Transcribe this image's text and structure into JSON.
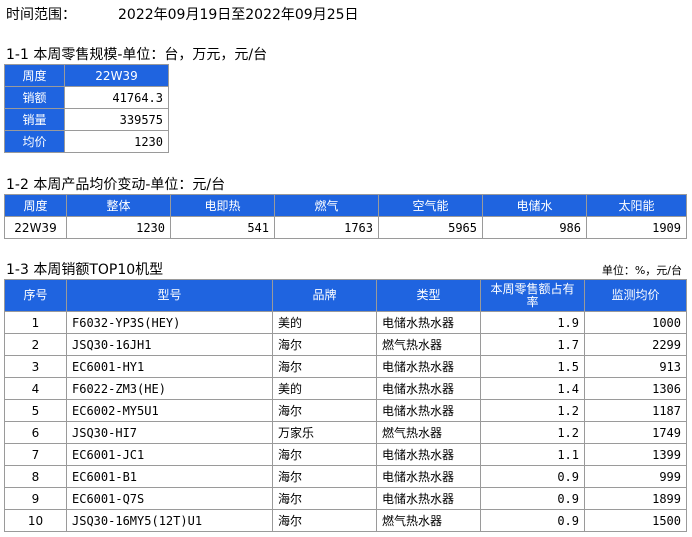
{
  "period": {
    "label": "时间范围：",
    "value": "2022年09月19日至2022年09月25日"
  },
  "section1": {
    "title": "1-1 本周零售规模-单位：台，万元，元/台",
    "rows": [
      {
        "label": "周度",
        "value": "22W39"
      },
      {
        "label": "销额",
        "value": "41764.3"
      },
      {
        "label": "销量",
        "value": "339575"
      },
      {
        "label": "均价",
        "value": "1230"
      }
    ]
  },
  "section2": {
    "title": "1-2 本周产品均价变动-单位：元/台",
    "headers": [
      "周度",
      "整体",
      "电即热",
      "燃气",
      "空气能",
      "电储水",
      "太阳能"
    ],
    "row": [
      "22W39",
      "1230",
      "541",
      "1763",
      "5965",
      "986",
      "1909"
    ]
  },
  "section3": {
    "title": "1-3 本周销额TOP10机型",
    "unit": "单位：%，元/台",
    "headers": [
      "序号",
      "型号",
      "品牌",
      "类型",
      "本周零售额占有率",
      "监测均价"
    ],
    "rows": [
      [
        "1",
        "F6032-YP3S(HEY)",
        "美的",
        "电储水热水器",
        "1.9",
        "1000"
      ],
      [
        "2",
        "JSQ30-16JH1",
        "海尔",
        "燃气热水器",
        "1.7",
        "2299"
      ],
      [
        "3",
        "EC6001-HY1",
        "海尔",
        "电储水热水器",
        "1.5",
        "913"
      ],
      [
        "4",
        "F6022-ZM3(HE)",
        "美的",
        "电储水热水器",
        "1.4",
        "1306"
      ],
      [
        "5",
        "EC6002-MY5U1",
        "海尔",
        "电储水热水器",
        "1.2",
        "1187"
      ],
      [
        "6",
        "JSQ30-HI7",
        "万家乐",
        "燃气热水器",
        "1.2",
        "1749"
      ],
      [
        "7",
        "EC6001-JC1",
        "海尔",
        "电储水热水器",
        "1.1",
        "1399"
      ],
      [
        "8",
        "EC6001-B1",
        "海尔",
        "电储水热水器",
        "0.9",
        "999"
      ],
      [
        "9",
        "EC6001-Q7S",
        "海尔",
        "电储水热水器",
        "0.9",
        "1899"
      ],
      [
        "10",
        "JSQ30-16MY5(12T)U1",
        "海尔",
        "燃气热水器",
        "0.9",
        "1500"
      ]
    ]
  }
}
